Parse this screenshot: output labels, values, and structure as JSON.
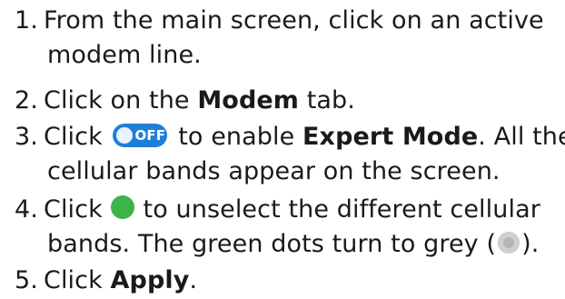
{
  "steps": [
    {
      "number": "1.",
      "line1": "From the main screen, click on an active",
      "line2": "modem line."
    },
    {
      "number": "2.",
      "pre": "Click on the ",
      "bold": "Modem",
      "post": " tab."
    },
    {
      "number": "3.",
      "pre": "Click",
      "toggle_label": "OFF",
      "mid": "to enable ",
      "bold": "Expert Mode",
      "post": ". All the",
      "line2": "cellular bands appear on the screen."
    },
    {
      "number": "4.",
      "pre": "Click",
      "mid": "to unselect the different cellular",
      "line2_pre": "bands. The green dots turn to grey (",
      "line2_post": ")."
    },
    {
      "number": "5.",
      "pre": "Click ",
      "bold": "Apply",
      "post": "."
    }
  ],
  "colors": {
    "toggle": "#1f7fd8",
    "green_dot": "#3bb54a",
    "grey_dot": "#b5b5b5"
  },
  "icons": {
    "toggle": "toggle-off-icon",
    "green": "green-dot-icon",
    "grey": "grey-dot-icon"
  }
}
